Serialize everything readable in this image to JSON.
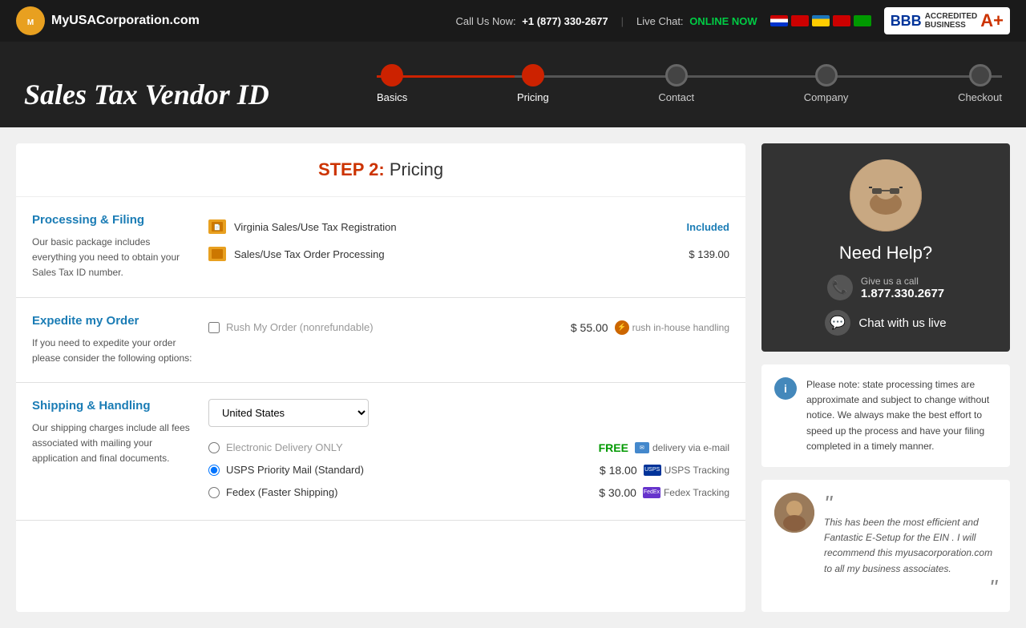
{
  "header": {
    "logo_text": "MyUSACorporation.com",
    "call_label": "Call Us Now:",
    "phone": "+1 (877) 330-2677",
    "live_chat_label": "Live Chat:",
    "online_status": "ONLINE NOW",
    "bbb_label": "BBB ACCREDITED BUSINESS A+"
  },
  "progress": {
    "title": "Sales Tax Vendor ID",
    "steps": [
      {
        "label": "Basics",
        "state": "active"
      },
      {
        "label": "Pricing",
        "state": "current"
      },
      {
        "label": "Contact",
        "state": "inactive"
      },
      {
        "label": "Company",
        "state": "inactive"
      },
      {
        "label": "Checkout",
        "state": "inactive"
      }
    ]
  },
  "step": {
    "number": "STEP 2:",
    "title": "Pricing"
  },
  "processing": {
    "title": "Processing & Filing",
    "description": "Our basic package includes everything you need to obtain your Sales Tax ID number.",
    "items": [
      {
        "name": "Virginia Sales/Use Tax Registration",
        "price": "Included",
        "price_type": "included"
      },
      {
        "name": "Sales/Use Tax Order Processing",
        "price": "$ 139.00",
        "price_type": "amount"
      }
    ]
  },
  "expedite": {
    "title": "Expedite my Order",
    "description": "If you need to expedite your order please consider the following options:",
    "items": [
      {
        "name": "Rush My Order (nonrefundable)",
        "price": "$ 55.00",
        "tag": "rush in-house handling"
      }
    ]
  },
  "shipping": {
    "title": "Shipping & Handling",
    "description": "Our shipping charges include all fees associated with mailing your application and final documents.",
    "country_label": "United States",
    "options": [
      {
        "name": "Electronic Delivery ONLY",
        "price": "FREE",
        "tag": "delivery via e-mail",
        "selected": false,
        "disabled": true
      },
      {
        "name": "USPS Priority Mail (Standard)",
        "price": "$ 18.00",
        "tag": "USPS Tracking",
        "selected": true,
        "disabled": false
      },
      {
        "name": "Fedex (Faster Shipping)",
        "price": "$ 30.00",
        "tag": "Fedex Tracking",
        "selected": false,
        "disabled": false
      }
    ]
  },
  "sidebar": {
    "help_title": "Need Help?",
    "give_call_label": "Give us a call",
    "phone_number": "1.877.330.2677",
    "chat_label": "Chat with us live",
    "notice": "Please note: state processing times are approximate and subject to change without notice. We always make the best effort to speed up the process and have your filing completed in a timely manner.",
    "testimonial": "This has been the most efficient and Fantastic E-Setup for the EIN . I will recommend this myusacorporation.com to all my business associates."
  }
}
